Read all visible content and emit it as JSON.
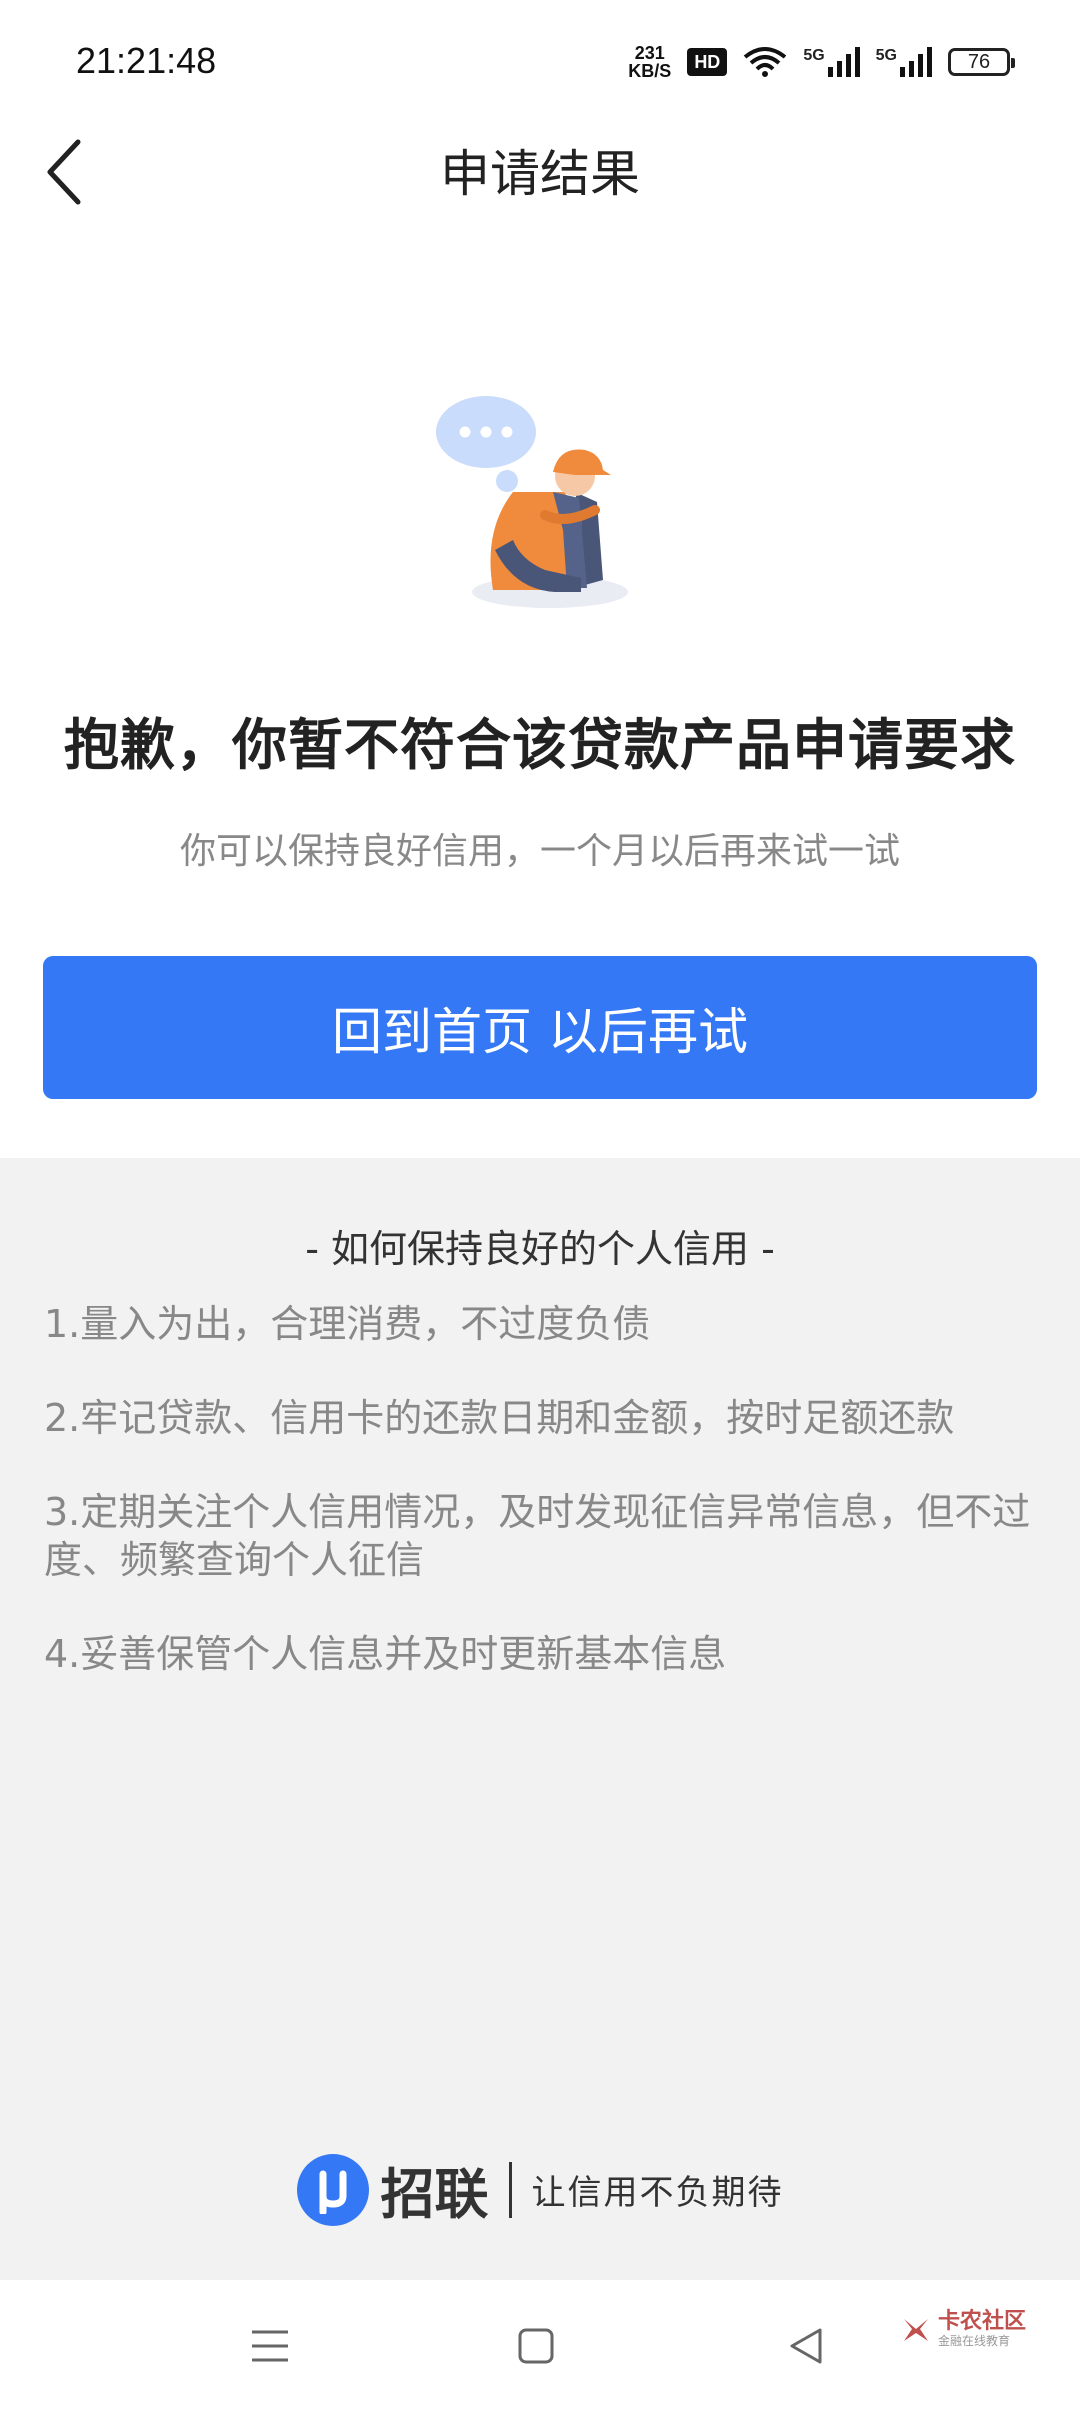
{
  "status_bar": {
    "time": "21:21:48",
    "net_speed_value": "231",
    "net_speed_unit": "KB/S",
    "hd": "HD",
    "signal_1": "5G",
    "signal_2": "5G",
    "battery": "76"
  },
  "header": {
    "title": "申请结果",
    "back_icon": "chevron-left-icon"
  },
  "result": {
    "illustration": "sad-person-illustration",
    "heading": "抱歉，你暂不符合该贷款产品申请要求",
    "subtext": "你可以保持良好信用，一个月以后再来试一试",
    "button_label": "回到首页 以后再试"
  },
  "tips": {
    "title": "- 如何保持良好的个人信用 -",
    "items": [
      "1.量入为出，合理消费，不过度负债",
      "2.牢记贷款、信用卡的还款日期和金额，按时足额还款",
      "3.定期关注个人信用情况，及时发现征信异常信息，但不过度、频繁查询个人征信",
      "4.妥善保管个人信息并及时更新基本信息"
    ]
  },
  "brand": {
    "logo": "u-logo",
    "name": "招联",
    "slogan": "让信用不负期待"
  },
  "watermark": {
    "text": "卡农社区",
    "sub": "金融在线教育"
  },
  "colors": {
    "primary": "#3478f6",
    "tips_background": "#f2f2f2",
    "accent_orange": "#f08a3c"
  }
}
